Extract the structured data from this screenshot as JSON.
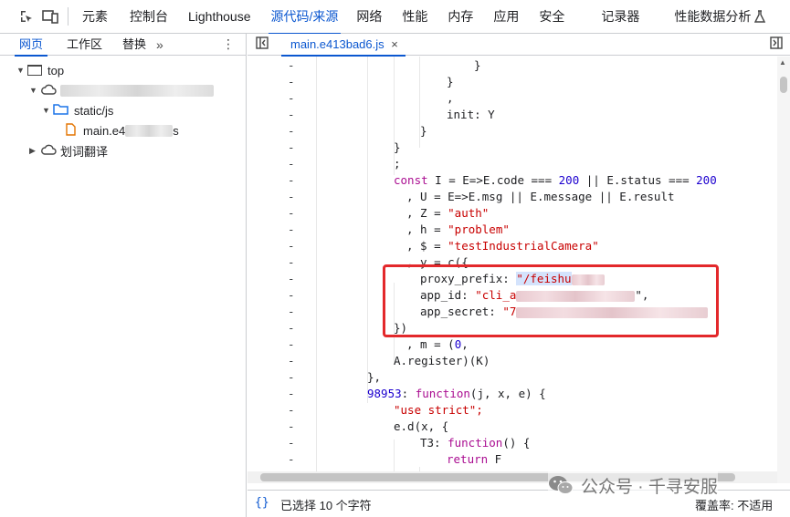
{
  "toolbar": {
    "tabs": [
      {
        "label": "元素",
        "active": false
      },
      {
        "label": "控制台",
        "active": false
      },
      {
        "label": "Lighthouse",
        "active": false
      },
      {
        "label": "源代码/来源",
        "active": true
      },
      {
        "label": "网络",
        "active": false
      },
      {
        "label": "性能",
        "active": false
      },
      {
        "label": "内存",
        "active": false
      },
      {
        "label": "应用",
        "active": false
      },
      {
        "label": "安全",
        "active": false
      },
      {
        "label": "记录器",
        "active": false
      },
      {
        "label": "性能数据分析",
        "active": false
      }
    ],
    "icons": [
      "inspect-icon",
      "device-toggle-icon",
      "flask-icon"
    ]
  },
  "sidebar": {
    "tabs": [
      {
        "label": "网页",
        "active": true
      },
      {
        "label": "工作区",
        "active": false
      },
      {
        "label": "替换",
        "active": false
      }
    ],
    "more": "»",
    "tree": {
      "top": "top",
      "folder": "static/js",
      "file_prefix": "main.e4",
      "file_suffix": "s",
      "extension": "划词翻译"
    }
  },
  "editor": {
    "file_tab": "main.e413bad6.js",
    "close": "×",
    "lines": {
      "l1": "}",
      "l2": "}",
      "l3": ",",
      "l4a": "init",
      "l4b": ": Y",
      "l5": "}",
      "l6": "}",
      "l7": ";",
      "l8a": "const",
      "l8b": " I = E=>E.code === ",
      "l8c": "200",
      "l8d": " || E.status === ",
      "l8e": "200",
      "l9": ", U = E=>E.msg || E.message || E.result",
      "l10a": ", Z = ",
      "l10b": "\"auth\"",
      "l11a": ", h = ",
      "l11b": "\"problem\"",
      "l12a": ", $ = ",
      "l12b": "\"testIndustrialCamera\"",
      "l13": ", y = c({",
      "l14a": "proxy_prefix: ",
      "l14b": "\"/feishu",
      "l15a": "app_id: ",
      "l15b": "\"cli_a",
      "l15c": "\",",
      "l16a": "app_secret: ",
      "l16b": "\"7",
      "l17": "})",
      "l18a": ", m = (",
      "l18b": "0",
      "l18c": ",",
      "l19": "A.register)(K)",
      "l20": "},",
      "l21a": "98953",
      "l21b": ": ",
      "l21c": "function",
      "l21d": "(j, x, e) {",
      "l22": "\"use strict\";",
      "l23": "e.d(x, {",
      "l24a": "T3: ",
      "l24b": "function",
      "l24c": "() {",
      "l25a": "return",
      "l25b": " F"
    }
  },
  "status": {
    "braces": "{}",
    "selection": "已选择 10 个字符",
    "coverage": "覆盖率: 不适用"
  },
  "watermark": {
    "text": "公众号 · 千寻安服"
  }
}
